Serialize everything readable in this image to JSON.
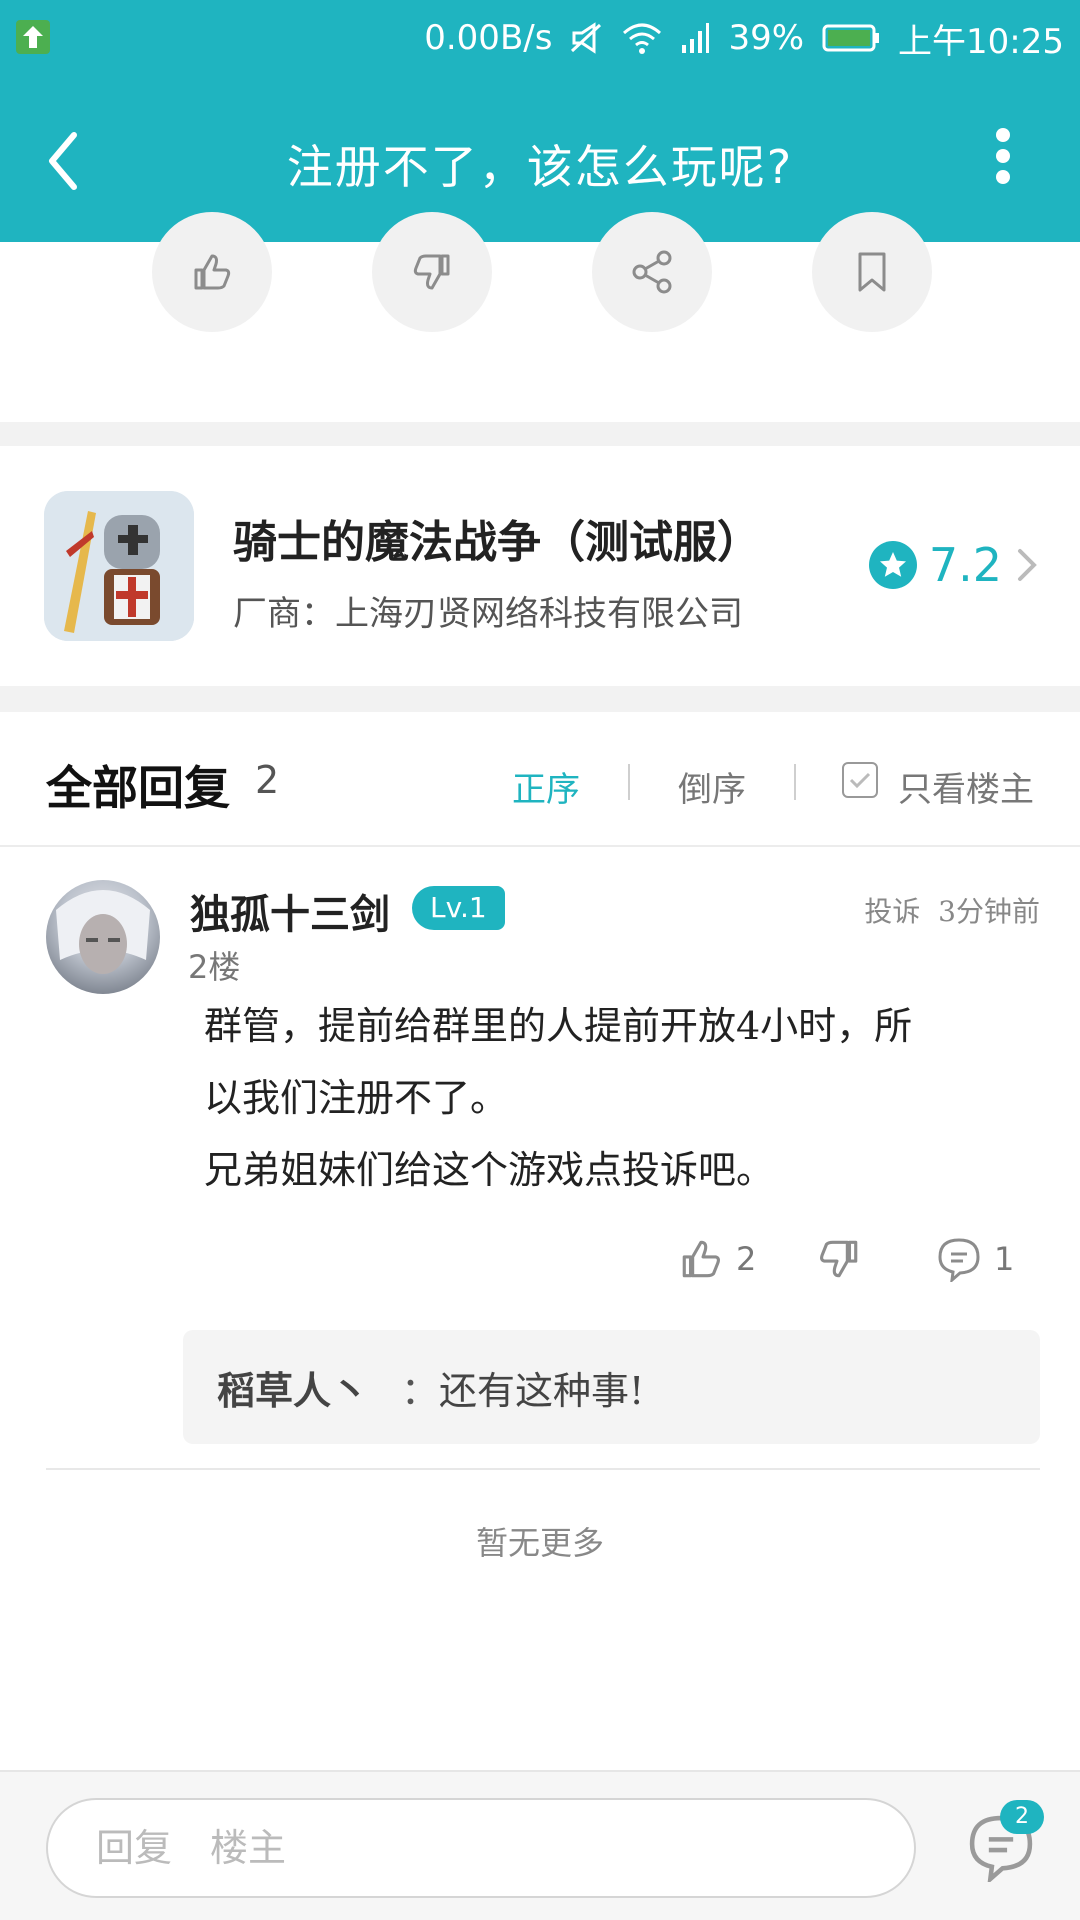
{
  "status_bar": {
    "speed": "0.00B/s",
    "battery": "39%",
    "time": "上午10:25"
  },
  "app_bar": {
    "title": "注册不了，该怎么玩呢?"
  },
  "colors": {
    "accent": "#1fb4c0",
    "badge": "#1fb4c0"
  },
  "game": {
    "name": "骑士的魔法战争（测试服）",
    "vendor": "厂商：上海刃贤网络科技有限公司",
    "rating": "7.2"
  },
  "replies": {
    "title": "全部回复",
    "count": "2",
    "sort_asc": "正序",
    "sort_desc": "倒序",
    "only_op": "只看楼主"
  },
  "reply": {
    "username": "独孤十三剑",
    "level": "Lv.1",
    "floor": "2楼",
    "report": "投诉",
    "time": "3分钟前",
    "content_line1": "群管，提前给群里的人提前开放4小时，所",
    "content_line2": "以我们注册不了。",
    "content_line3": "兄弟姐妹们给这个游戏点投诉吧。",
    "likes": "2",
    "comments": "1"
  },
  "sub_reply": {
    "user": "稻草人丶",
    "sep": "：",
    "text": "还有这种事!"
  },
  "footer": {
    "no_more": "暂无更多"
  },
  "bottom_bar": {
    "placeholder": "回复　楼主",
    "badge": "2"
  }
}
